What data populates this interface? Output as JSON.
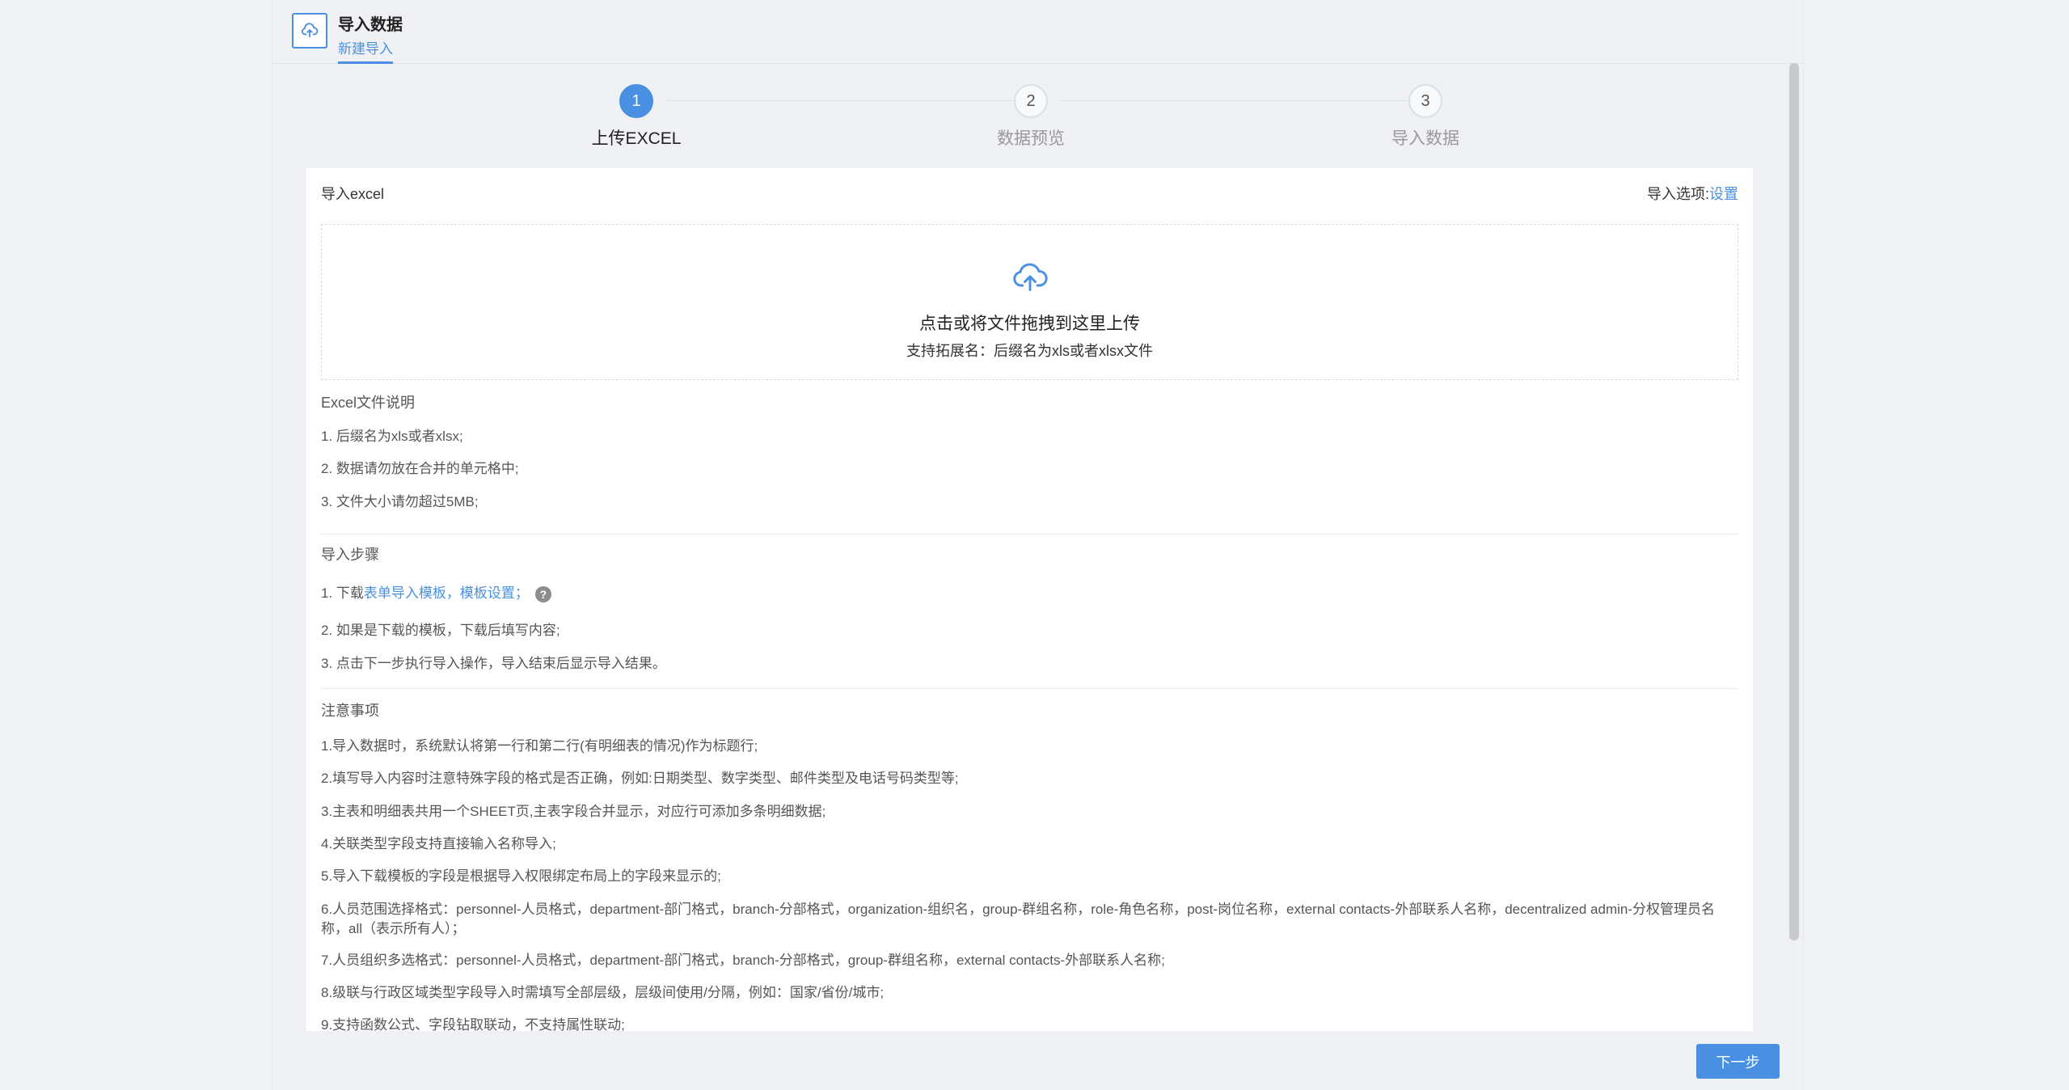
{
  "header": {
    "title": "导入数据",
    "tab": "新建导入",
    "icon": "cloud-upload-icon"
  },
  "steps": [
    {
      "number": "1",
      "label": "上传EXCEL",
      "state": "active"
    },
    {
      "number": "2",
      "label": "数据预览",
      "state": "inactive"
    },
    {
      "number": "3",
      "label": "导入数据",
      "state": "inactive"
    }
  ],
  "card": {
    "title": "导入excel",
    "options_label": "导入选项:",
    "options_link": "设置"
  },
  "dropzone": {
    "icon": "cloud-upload-icon",
    "text": "点击或将文件拖拽到这里上传",
    "hint": "支持拓展名：后缀名为xls或者xlsx文件"
  },
  "excel_notes": {
    "title": "Excel文件说明",
    "items": [
      "1. 后缀名为xls或者xlsx;",
      "2. 数据请勿放在合并的单元格中;",
      "3. 文件大小请勿超过5MB;"
    ]
  },
  "import_steps": {
    "title": "导入步骤",
    "step1_prefix": "1. 下载",
    "step1_link": "表单导入模板，模板设置；",
    "items": [
      "2. 如果是下载的模板，下载后填写内容;",
      "3. 点击下一步执行导入操作，导入结束后显示导入结果。"
    ]
  },
  "notices": {
    "title": "注意事项",
    "items": [
      "1.导入数据时，系统默认将第一行和第二行(有明细表的情况)作为标题行;",
      "2.填写导入内容时注意特殊字段的格式是否正确，例如:日期类型、数字类型、邮件类型及电话号码类型等;",
      "3.主表和明细表共用一个SHEET页,主表字段合并显示，对应行可添加多条明细数据;",
      "4.关联类型字段支持直接输入名称导入;",
      "5.导入下载模板的字段是根据导入权限绑定布局上的字段来显示的;",
      "6.人员范围选择格式：personnel-人员格式，department-部门格式，branch-分部格式，organization-组织名，group-群组名称，role-角色名称，post-岗位名称，external contacts-外部联系人名称，decentralized admin-分权管理员名称，all（表示所有人）；",
      "7.人员组织多选格式：personnel-人员格式，department-部门格式，branch-分部格式，group-群组名称，external contacts-外部联系人名称;",
      "8.级联与行政区域类型字段导入时需填写全部层级，层级间使用/分隔，例如：国家/省份/城市;",
      "9.支持函数公式、字段钻取联动，不支持属性联动;"
    ]
  },
  "footer": {
    "next_label": "下一步"
  },
  "colors": {
    "accent": "#4a90e2",
    "background": "#f0f1f5"
  }
}
